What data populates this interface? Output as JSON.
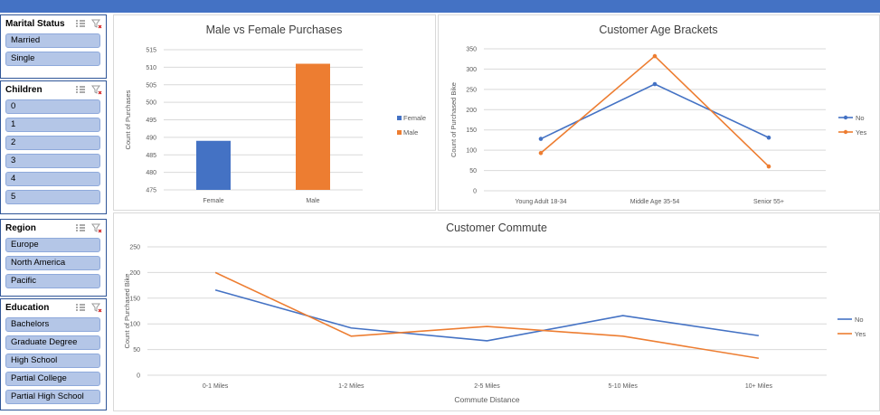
{
  "slicers": {
    "marital_status": {
      "title": "Marital Status",
      "items": [
        "Married",
        "Single"
      ]
    },
    "children": {
      "title": "Children",
      "items": [
        "0",
        "1",
        "2",
        "3",
        "4",
        "5"
      ]
    },
    "region": {
      "title": "Region",
      "items": [
        "Europe",
        "North America",
        "Pacific"
      ]
    },
    "education": {
      "title": "Education",
      "items": [
        "Bachelors",
        "Graduate Degree",
        "High School",
        "Partial College",
        "Partial High School"
      ]
    }
  },
  "colors": {
    "blue": "#4472c4",
    "orange": "#ed7d31",
    "slicer_item": "#b4c6e7"
  },
  "icons": {
    "multi_select": "multi-select-icon",
    "clear_filter": "clear-filter-icon"
  },
  "chart_data": [
    {
      "type": "bar",
      "title": "Male vs Female Purchases",
      "ylabel": "Count of Purchases",
      "categories": [
        "Female",
        "Male"
      ],
      "series": [
        {
          "name": "Female",
          "values": [
            489,
            null
          ],
          "color": "#4472c4"
        },
        {
          "name": "Male",
          "values": [
            null,
            511
          ],
          "color": "#ed7d31"
        }
      ],
      "ylim": [
        475,
        515
      ],
      "yticks": [
        475,
        480,
        485,
        490,
        495,
        500,
        505,
        510,
        515
      ],
      "legend": "right"
    },
    {
      "type": "line",
      "title": "Customer Age Brackets",
      "ylabel": "Count of Purchased Bike",
      "categories": [
        "Young Adult 18-34",
        "Middle Age 35-54",
        "Senior 55+"
      ],
      "series": [
        {
          "name": "No",
          "values": [
            128,
            263,
            131
          ],
          "color": "#4472c4"
        },
        {
          "name": "Yes",
          "values": [
            93,
            332,
            60
          ],
          "color": "#ed7d31"
        }
      ],
      "ylim": [
        0,
        350
      ],
      "yticks": [
        0,
        50,
        100,
        150,
        200,
        250,
        300,
        350
      ],
      "markers": true,
      "legend": "right"
    },
    {
      "type": "line",
      "title": "Customer Commute",
      "xlabel": "Commute Distance",
      "ylabel": "Count of Purchased Bike",
      "categories": [
        "0-1 Miles",
        "1-2 Miles",
        "2-5 Miles",
        "5-10 Miles",
        "10+ Miles"
      ],
      "series": [
        {
          "name": "No",
          "values": [
            166,
            92,
            67,
            116,
            77
          ],
          "color": "#4472c4"
        },
        {
          "name": "Yes",
          "values": [
            200,
            76,
            95,
            76,
            33
          ],
          "color": "#ed7d31"
        }
      ],
      "ylim": [
        0,
        250
      ],
      "yticks": [
        0,
        50,
        100,
        150,
        200,
        250
      ],
      "markers": false,
      "legend": "right"
    }
  ]
}
